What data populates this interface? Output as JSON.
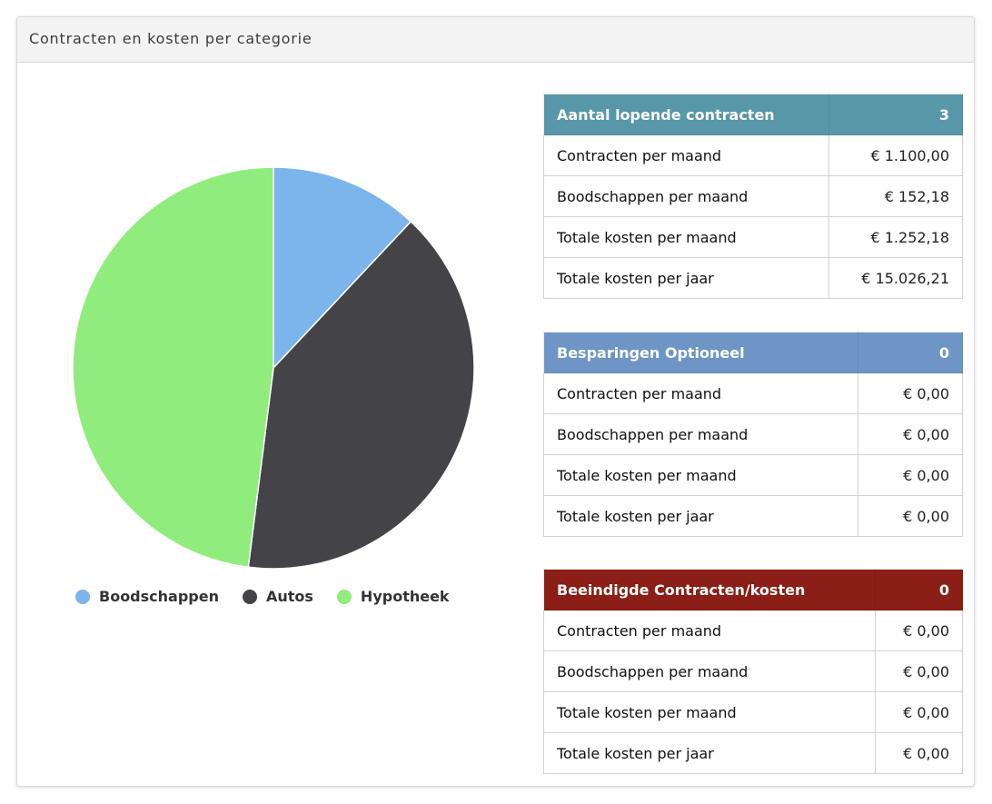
{
  "panel": {
    "title": "Contracten en kosten per categorie"
  },
  "chart_data": {
    "type": "pie",
    "labels": [
      "Boodschappen",
      "Autos",
      "Hypotheek"
    ],
    "values": [
      12,
      40,
      48
    ],
    "colors": [
      "#7cb5ec",
      "#434348",
      "#90ed7d"
    ],
    "legend": "bottom"
  },
  "tables": [
    {
      "title": "Aantal lopende contracten",
      "count": "3",
      "color": "#5797a9",
      "rows": [
        {
          "label": "Contracten per maand",
          "value": "€ 1.100,00"
        },
        {
          "label": "Boodschappen per maand",
          "value": "€ 152,18"
        },
        {
          "label": "Totale kosten per maand",
          "value": "€ 1.252,18"
        },
        {
          "label": "Totale kosten per jaar",
          "value": "€ 15.026,21"
        }
      ]
    },
    {
      "title": "Besparingen Optioneel",
      "count": "0",
      "color": "#6f95c7",
      "rows": [
        {
          "label": "Contracten per maand",
          "value": "€ 0,00"
        },
        {
          "label": "Boodschappen per maand",
          "value": "€ 0,00"
        },
        {
          "label": "Totale kosten per maand",
          "value": "€ 0,00"
        },
        {
          "label": "Totale kosten per jaar",
          "value": "€ 0,00"
        }
      ]
    },
    {
      "title": "Beeindigde Contracten/kosten",
      "count": "0",
      "color": "#8b1e16",
      "rows": [
        {
          "label": "Contracten per maand",
          "value": "€ 0,00"
        },
        {
          "label": "Boodschappen per maand",
          "value": "€ 0,00"
        },
        {
          "label": "Totale kosten per maand",
          "value": "€ 0,00"
        },
        {
          "label": "Totale kosten per jaar",
          "value": "€ 0,00"
        }
      ]
    }
  ]
}
